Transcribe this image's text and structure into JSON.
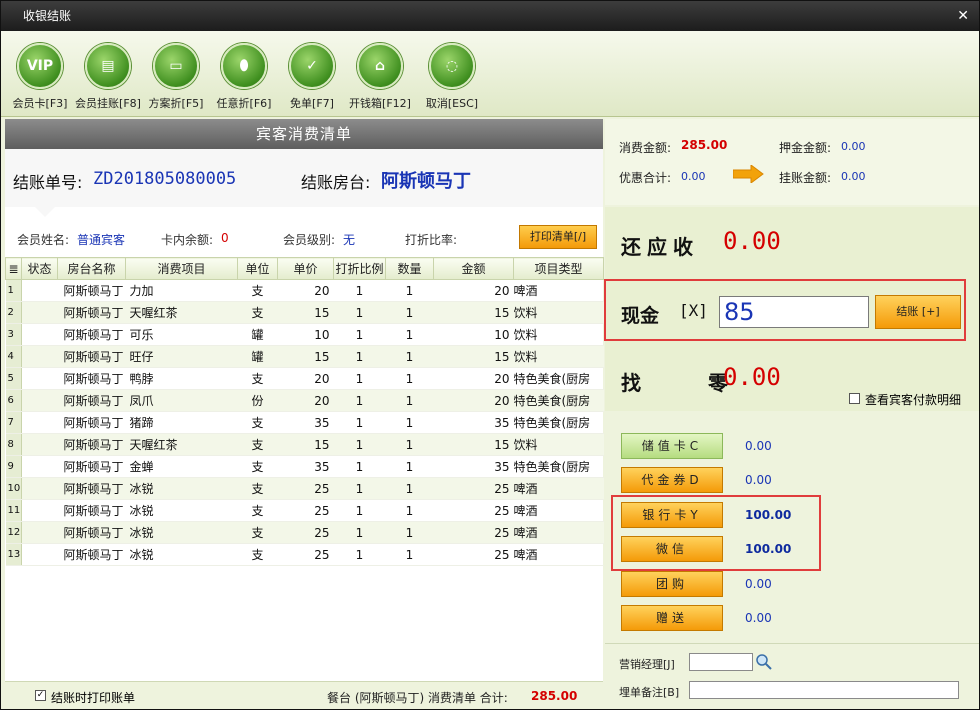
{
  "window": {
    "title": "收银结账",
    "close": "✕"
  },
  "toolbar": [
    {
      "icon": "vip-card-icon",
      "glyph": "VIP",
      "label": "会员卡[F3]"
    },
    {
      "icon": "member-charge-icon",
      "glyph": "▤",
      "label": "会员挂账[F8]"
    },
    {
      "icon": "plan-discount-icon",
      "glyph": "▭",
      "label": "方案折[F5]"
    },
    {
      "icon": "any-discount-icon",
      "glyph": "⬮",
      "label": "任意折[F6]"
    },
    {
      "icon": "free-bill-icon",
      "glyph": "✓",
      "label": "免单[F7]"
    },
    {
      "icon": "cash-drawer-icon",
      "glyph": "⌂",
      "label": "开钱箱[F12]"
    },
    {
      "icon": "cancel-icon",
      "glyph": "◌",
      "label": "取消[ESC]"
    }
  ],
  "left": {
    "header": "宾客消费清单",
    "bill_no_label": "结账单号:",
    "bill_no": "ZD201805080005",
    "room_label": "结账房台:",
    "room": "阿斯顿马丁",
    "member_name_label": "会员姓名:",
    "member_name": "普通宾客",
    "card_balance_label": "卡内余额:",
    "card_balance": "0",
    "member_level_label": "会员级别:",
    "member_level": "无",
    "discount_rate_label": "打折比率:",
    "discount_rate": "",
    "print_button": "打印清单[/]"
  },
  "table": {
    "headers": [
      "≣",
      "状态",
      "房台名称",
      "消费项目",
      "单位",
      "单价",
      "打折比例",
      "数量",
      "金额",
      "项目类型"
    ],
    "rows": [
      [
        "1",
        "",
        "阿斯顿马丁",
        "力加",
        "支",
        "20",
        "1",
        "1",
        "20",
        "啤酒"
      ],
      [
        "2",
        "",
        "阿斯顿马丁",
        "天喔红茶",
        "支",
        "15",
        "1",
        "1",
        "15",
        "饮料"
      ],
      [
        "3",
        "",
        "阿斯顿马丁",
        "可乐",
        "罐",
        "10",
        "1",
        "1",
        "10",
        "饮料"
      ],
      [
        "4",
        "",
        "阿斯顿马丁",
        "旺仔",
        "罐",
        "15",
        "1",
        "1",
        "15",
        "饮料"
      ],
      [
        "5",
        "",
        "阿斯顿马丁",
        "鸭脖",
        "支",
        "20",
        "1",
        "1",
        "20",
        "特色美食(厨房"
      ],
      [
        "6",
        "",
        "阿斯顿马丁",
        "凤爪",
        "份",
        "20",
        "1",
        "1",
        "20",
        "特色美食(厨房"
      ],
      [
        "7",
        "",
        "阿斯顿马丁",
        "猪蹄",
        "支",
        "35",
        "1",
        "1",
        "35",
        "特色美食(厨房"
      ],
      [
        "8",
        "",
        "阿斯顿马丁",
        "天喔红茶",
        "支",
        "15",
        "1",
        "1",
        "15",
        "饮料"
      ],
      [
        "9",
        "",
        "阿斯顿马丁",
        "金蝉",
        "支",
        "35",
        "1",
        "1",
        "35",
        "特色美食(厨房"
      ],
      [
        "10",
        "",
        "阿斯顿马丁",
        "冰锐",
        "支",
        "25",
        "1",
        "1",
        "25",
        "啤酒"
      ],
      [
        "11",
        "",
        "阿斯顿马丁",
        "冰锐",
        "支",
        "25",
        "1",
        "1",
        "25",
        "啤酒"
      ],
      [
        "12",
        "",
        "阿斯顿马丁",
        "冰锐",
        "支",
        "25",
        "1",
        "1",
        "25",
        "啤酒"
      ],
      [
        "13",
        "",
        "阿斯顿马丁",
        "冰锐",
        "支",
        "25",
        "1",
        "1",
        "25",
        "啤酒"
      ]
    ]
  },
  "footer": {
    "print_on_checkout": "结账时打印账单",
    "print_checked": true,
    "summary_prefix": "餐台 (阿斯顿马丁) 消费清单 合计:",
    "total": "285.00"
  },
  "right": {
    "consume_label": "消费金额:",
    "consume": "285.00",
    "deposit_label": "押金金额:",
    "deposit": "0.00",
    "discount_total_label": "优惠合计:",
    "discount_total": "0.00",
    "charge_label": "挂账金额:",
    "charge": "0.00",
    "due_label": "还应收",
    "due": "0.00",
    "cash_label": "现金",
    "cash_key": "[X]",
    "cash_value": "85",
    "pay_button": "结账 [+]",
    "change_label": "找 零",
    "change": "0.00",
    "view_detail": "查看宾客付款明细",
    "methods": [
      {
        "label": "储值卡C",
        "value": "0.00",
        "style": "green"
      },
      {
        "label": "代金券D",
        "value": "0.00",
        "style": "orange"
      },
      {
        "label": "银行卡Y",
        "value": "100.00",
        "style": "orange"
      },
      {
        "label": "微信",
        "value": "100.00",
        "style": "orange"
      },
      {
        "label": "团购",
        "value": "0.00",
        "style": "orange"
      },
      {
        "label": "赠送",
        "value": "0.00",
        "style": "orange"
      }
    ],
    "manager_label": "营销经理[J]",
    "manager_value": "",
    "remark_label": "埋单备注[B]",
    "remark_value": ""
  }
}
